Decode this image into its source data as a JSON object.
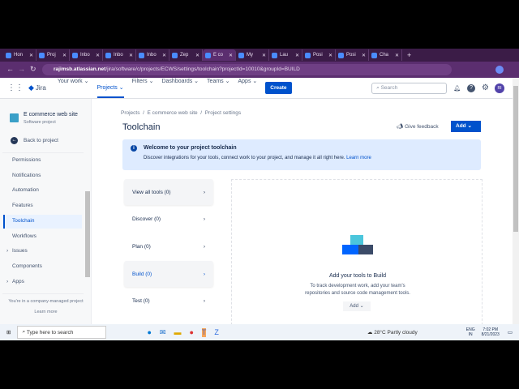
{
  "browser": {
    "tabs": [
      {
        "label": "Hon"
      },
      {
        "label": "Proj"
      },
      {
        "label": "Inbo"
      },
      {
        "label": "Inbo"
      },
      {
        "label": "Inbo"
      },
      {
        "label": "Zep"
      },
      {
        "label": "E co",
        "active": true
      },
      {
        "label": "My"
      },
      {
        "label": "Lau"
      },
      {
        "label": "Posi"
      },
      {
        "label": "Posi"
      },
      {
        "label": "Cha"
      }
    ],
    "url_host": "rajimsb.atlassian.net",
    "url_path": "/jira/software/c/projects/ECWS/settings/toolchain?projectId=10010&groupId=BUILD"
  },
  "nav": {
    "logo": "Jira",
    "items": [
      "Your work",
      "Projects",
      "Filters",
      "Dashboards",
      "Teams",
      "Apps"
    ],
    "active": "Projects",
    "create": "Create",
    "search_placeholder": "Search",
    "avatar": "RI"
  },
  "sidebar": {
    "project_name": "E commerce web site",
    "project_type": "Software project",
    "back": "Back to project",
    "items": [
      {
        "label": "Permissions"
      },
      {
        "label": "Notifications"
      },
      {
        "label": "Automation"
      },
      {
        "label": "Features"
      },
      {
        "label": "Toolchain",
        "active": true
      },
      {
        "label": "Workflows"
      },
      {
        "label": "Issues",
        "expand": true
      },
      {
        "label": "Components"
      },
      {
        "label": "Apps",
        "expand": true
      }
    ],
    "footer": "You're in a company-managed project",
    "learn_more": "Learn more"
  },
  "main": {
    "breadcrumb": [
      "Projects",
      "E commerce web site",
      "Project settings"
    ],
    "title": "Toolchain",
    "feedback": "Give feedback",
    "add": "Add",
    "banner": {
      "title": "Welcome to your project toolchain",
      "text": "Discover integrations for your tools, connect work to your project, and manage it all right here.",
      "link": "Learn more"
    },
    "categories": [
      {
        "label": "View all tools (0)"
      },
      {
        "label": "Discover (0)"
      },
      {
        "label": "Plan (0)"
      },
      {
        "label": "Build (0)",
        "selected": true
      },
      {
        "label": "Test (0)"
      }
    ],
    "empty": {
      "title": "Add your tools to Build",
      "text1": "To track development work, add your team's",
      "text2": "repositories and source code management tools.",
      "add": "Add"
    }
  },
  "taskbar": {
    "search": "Type here to search",
    "weather": "28°C  Partly cloudy",
    "lang1": "ENG",
    "lang2": "IN",
    "time": "7:02 PM",
    "date": "8/21/2023"
  },
  "colors": {
    "primary": "#0052cc",
    "banner": "#deebff",
    "browser": "#5b2e6f"
  }
}
